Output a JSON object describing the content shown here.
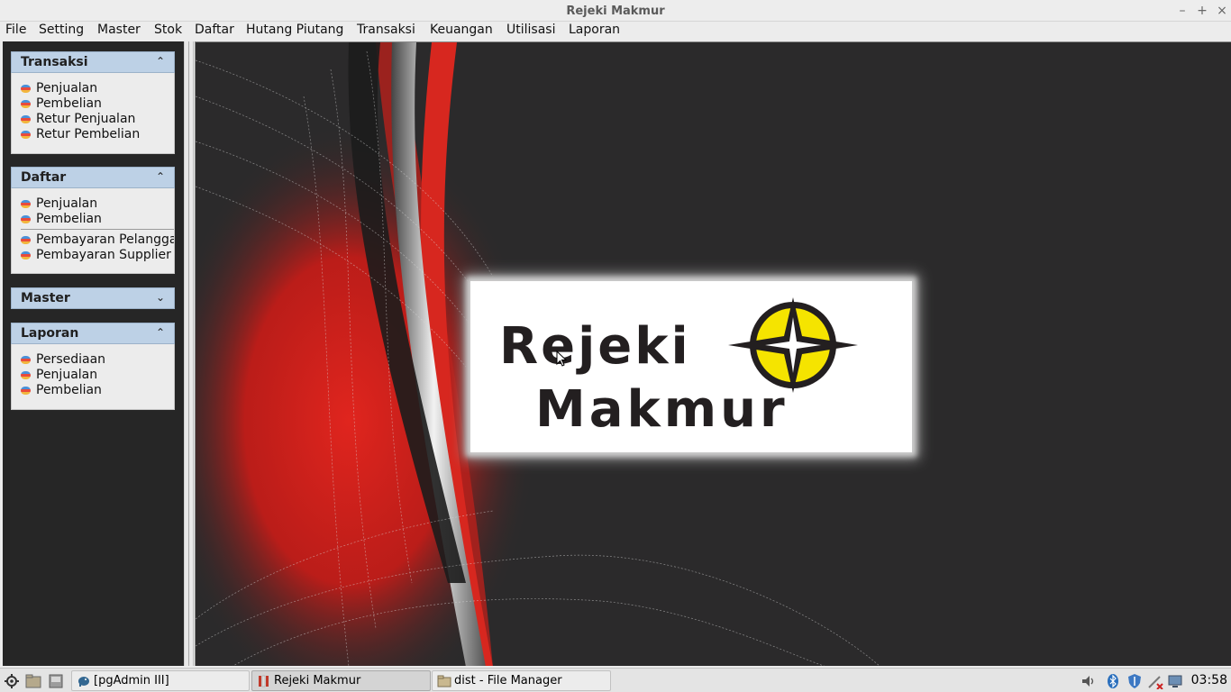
{
  "window": {
    "title": "Rejeki Makmur"
  },
  "menu": [
    {
      "label": "File"
    },
    {
      "label": "Setting"
    },
    {
      "label": "Master"
    },
    {
      "label": "Stok"
    },
    {
      "label": "Daftar"
    },
    {
      "label": "Hutang Piutang"
    },
    {
      "label": "Transaksi"
    },
    {
      "label": "Keuangan"
    },
    {
      "label": "Utilisasi"
    },
    {
      "label": "Laporan"
    }
  ],
  "taskpane": {
    "transaksi": {
      "title": "Transaksi",
      "expanded": true,
      "links": [
        "Penjualan",
        "Pembelian",
        "Retur Penjualan",
        "Retur Pembelian"
      ]
    },
    "daftar": {
      "title": "Daftar",
      "expanded": true,
      "links": [
        "Penjualan",
        "Pembelian",
        "Pembayaran Pelanggan",
        "Pembayaran Supplier"
      ]
    },
    "master": {
      "title": "Master",
      "expanded": false
    },
    "laporan": {
      "title": "Laporan",
      "expanded": true,
      "links": [
        "Persediaan",
        "Penjualan",
        "Pembelian"
      ]
    }
  },
  "logo": {
    "line1": "Rejeki",
    "line2": "Makmur"
  },
  "taskbar": {
    "windows": [
      {
        "label": "[pgAdmin III]",
        "active": false,
        "icon": "elephant-icon"
      },
      {
        "label": "Rejeki Makmur",
        "active": true,
        "icon": "java-app-icon"
      },
      {
        "label": "dist - File Manager",
        "active": false,
        "icon": "folder-icon"
      }
    ],
    "clock": "03:58"
  },
  "colors": {
    "accent_header": "#bdd1e6",
    "desktop_bg": "#2b2a2b",
    "logo_yellow": "#f5e400"
  }
}
